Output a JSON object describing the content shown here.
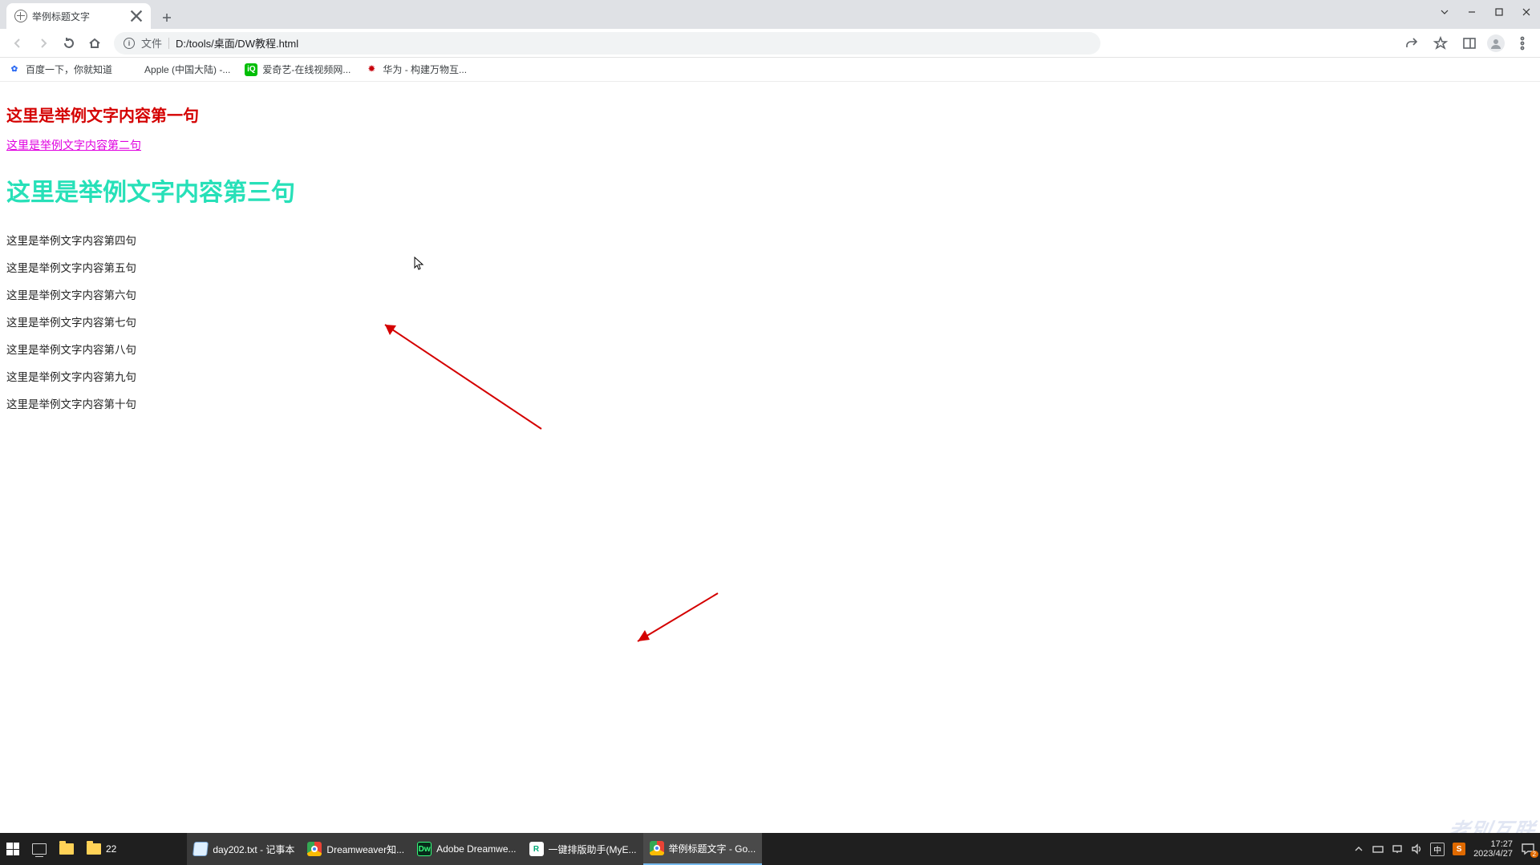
{
  "browser": {
    "tab_title": "举例标题文字",
    "omnibox_prefix": "文件",
    "url": "D:/tools/桌面/DW教程.html"
  },
  "bookmarks": [
    {
      "icon": "baidu",
      "label": "百度一下，你就知道"
    },
    {
      "icon": "apple",
      "label": "Apple (中国大陆) -..."
    },
    {
      "icon": "iqiyi",
      "label": "爱奇艺-在线视频网..."
    },
    {
      "icon": "huawei",
      "label": "华为 - 构建万物互..."
    }
  ],
  "content": {
    "line1": "这里是举例文字内容第一句",
    "line2": "这里是举例文字内容第二句",
    "line3": "这里是举例文字内容第三句",
    "plain": [
      "这里是举例文字内容第四句",
      "这里是举例文字内容第五句",
      "这里是举例文字内容第六句",
      "这里是举例文字内容第七句",
      "这里是举例文字内容第八句",
      "这里是举例文字内容第九句",
      "这里是举例文字内容第十句"
    ]
  },
  "taskbar": {
    "pinned_folder": "22",
    "apps": [
      {
        "icon": "notepad",
        "label": "day202.txt - 记事本"
      },
      {
        "icon": "chrome",
        "label": "Dreamweaver知..."
      },
      {
        "icon": "dw",
        "label": "Adobe Dreamwe..."
      },
      {
        "icon": "r",
        "label": "一键排版助手(MyE..."
      },
      {
        "icon": "chrome",
        "label": "举例标题文字 - Go...",
        "active": true
      }
    ],
    "ime": "中",
    "time": "17:27",
    "date": "2023/4/27",
    "notif_count": "2"
  }
}
